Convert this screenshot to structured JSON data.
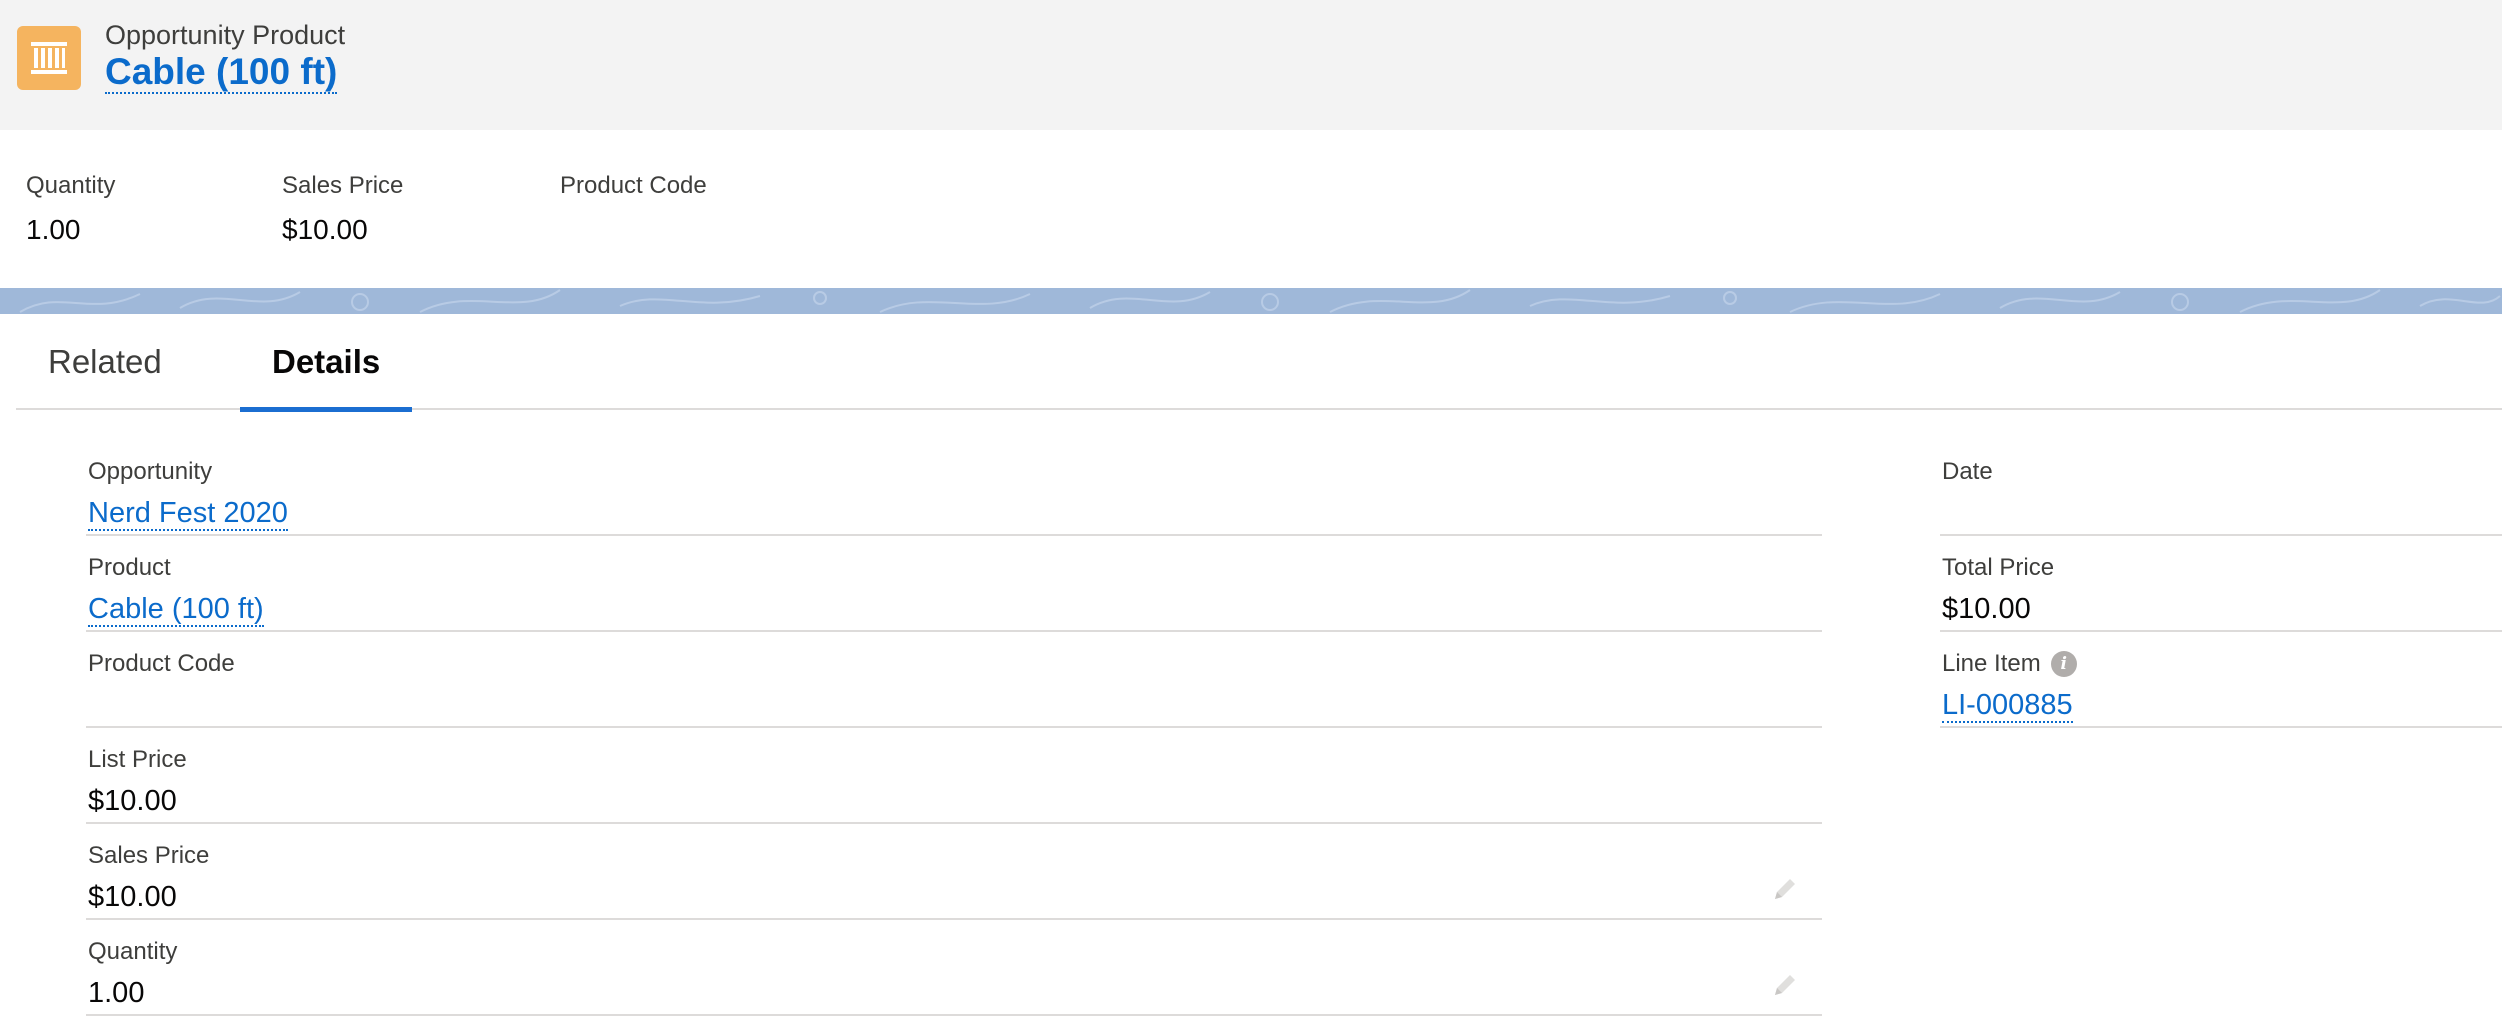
{
  "header": {
    "object_type": "Opportunity Product",
    "record_name": "Cable (100 ft)",
    "icon": "opportunity-product-icon"
  },
  "highlights": [
    {
      "label": "Quantity",
      "value": "1.00"
    },
    {
      "label": "Sales Price",
      "value": "$10.00"
    },
    {
      "label": "Product Code",
      "value": ""
    }
  ],
  "tabs": [
    {
      "label": "Related",
      "active": false
    },
    {
      "label": "Details",
      "active": true
    }
  ],
  "details": {
    "left": [
      {
        "label": "Opportunity",
        "value": "Nerd Fest 2020",
        "link": true
      },
      {
        "label": "Product",
        "value": "Cable (100 ft)",
        "link": true
      },
      {
        "label": "Product Code",
        "value": ""
      },
      {
        "label": "List Price",
        "value": "$10.00"
      },
      {
        "label": "Sales Price",
        "value": "$10.00",
        "editable": true
      },
      {
        "label": "Quantity",
        "value": "1.00",
        "editable": true
      }
    ],
    "right": [
      {
        "label": "Date",
        "value": ""
      },
      {
        "label": "Total Price",
        "value": "$10.00"
      },
      {
        "label": "Line Item",
        "value": "LI-000885",
        "link": true,
        "info_icon": true
      }
    ]
  },
  "colors": {
    "link": "#0b6bcb",
    "tab_active": "#1b6ed1",
    "icon_bg": "#f5b45f",
    "band": "#9fb8d9"
  }
}
